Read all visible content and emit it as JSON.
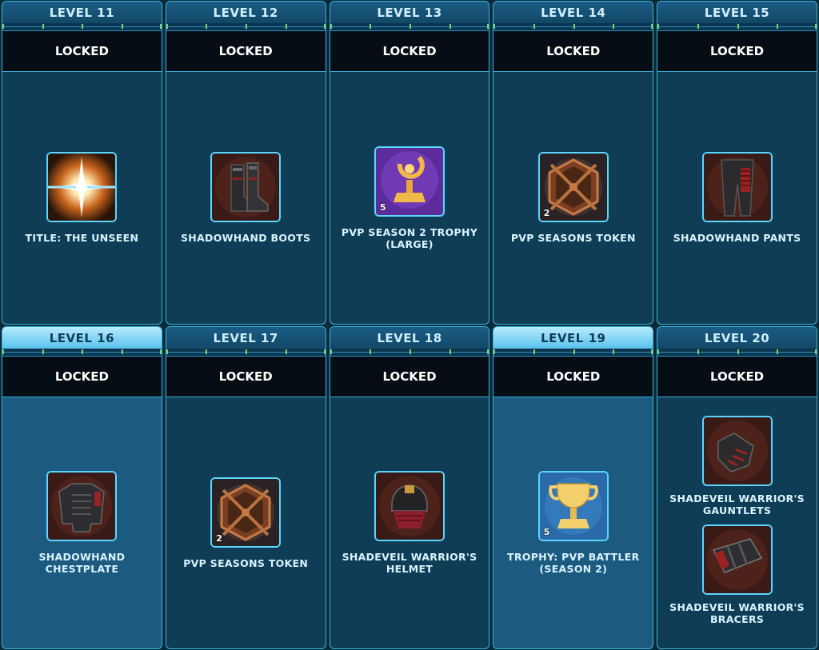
{
  "cards": [
    {
      "level": "LEVEL 11",
      "status": "LOCKED",
      "highlight": false,
      "rewards": [
        {
          "name": "TITLE: THE UNSEEN",
          "icon": "star-burst-icon",
          "qty": ""
        }
      ]
    },
    {
      "level": "LEVEL 12",
      "status": "LOCKED",
      "highlight": false,
      "rewards": [
        {
          "name": "SHADOWHAND BOOTS",
          "icon": "boots-icon",
          "qty": ""
        }
      ]
    },
    {
      "level": "LEVEL 13",
      "status": "LOCKED",
      "highlight": false,
      "rewards": [
        {
          "name": "PVP SEASON 2 TROPHY (LARGE)",
          "icon": "pvp-trophy-icon",
          "qty": "5"
        }
      ]
    },
    {
      "level": "LEVEL 14",
      "status": "LOCKED",
      "highlight": false,
      "rewards": [
        {
          "name": "PVP SEASONS TOKEN",
          "icon": "pvp-token-icon",
          "qty": "2"
        }
      ]
    },
    {
      "level": "LEVEL 15",
      "status": "LOCKED",
      "highlight": false,
      "rewards": [
        {
          "name": "SHADOWHAND PANTS",
          "icon": "pants-icon",
          "qty": ""
        }
      ]
    },
    {
      "level": "LEVEL 16",
      "status": "LOCKED",
      "highlight": true,
      "rewards": [
        {
          "name": "SHADOWHAND CHESTPLATE",
          "icon": "chestplate-icon",
          "qty": ""
        }
      ]
    },
    {
      "level": "LEVEL 17",
      "status": "LOCKED",
      "highlight": false,
      "rewards": [
        {
          "name": "PVP SEASONS TOKEN",
          "icon": "pvp-token-icon",
          "qty": "2"
        }
      ]
    },
    {
      "level": "LEVEL 18",
      "status": "LOCKED",
      "highlight": false,
      "rewards": [
        {
          "name": "SHADEVEIL WARRIOR'S HELMET",
          "icon": "helmet-icon",
          "qty": ""
        }
      ]
    },
    {
      "level": "LEVEL 19",
      "status": "LOCKED",
      "highlight": true,
      "rewards": [
        {
          "name": "TROPHY: PVP BATTLER (SEASON 2)",
          "icon": "gold-trophy-icon",
          "qty": "5"
        }
      ]
    },
    {
      "level": "LEVEL 20",
      "status": "LOCKED",
      "highlight": false,
      "rewards": [
        {
          "name": "SHADEVEIL WARRIOR'S GAUNTLETS",
          "icon": "gauntlets-icon",
          "qty": ""
        },
        {
          "name": "SHADEVEIL WARRIOR'S BRACERS",
          "icon": "bracers-icon",
          "qty": ""
        }
      ]
    }
  ],
  "colors": {
    "accent": "#3ab5e0",
    "card_bg": "#0f3d55",
    "card_highlight_bg": "#1c5a80",
    "status_bg": "#060d14",
    "tick": "#7ad36a"
  }
}
